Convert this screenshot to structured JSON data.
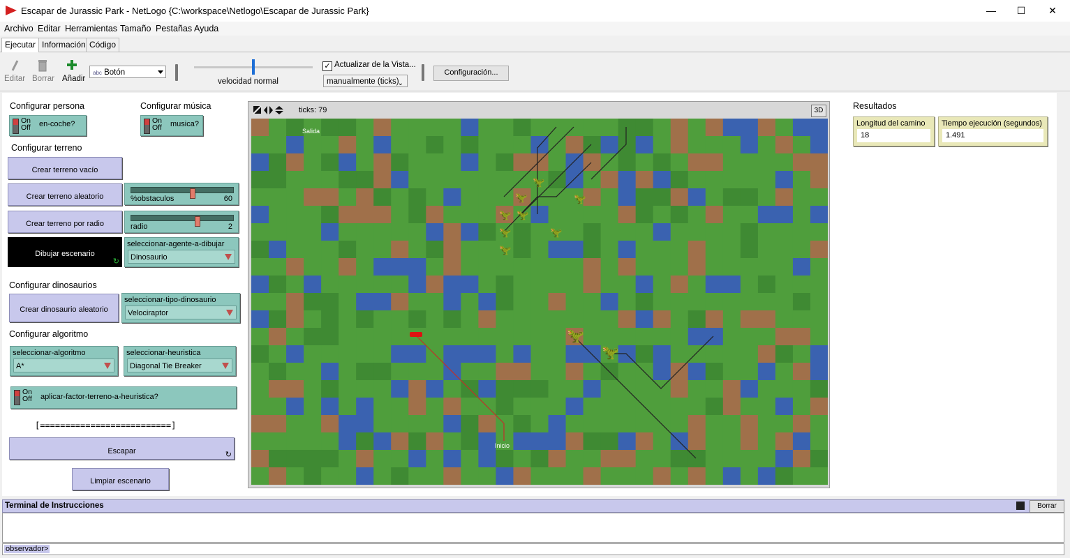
{
  "window": {
    "title": "Escapar de Jurassic Park - NetLogo {C:\\workspace\\Netlogo\\Escapar de Jurassic Park}",
    "minimize": "—",
    "maximize": "☐",
    "close": "✕"
  },
  "menu": [
    "Archivo",
    "Editar",
    "Herramientas",
    "Tamaño",
    "Pestañas",
    "Ayuda"
  ],
  "tabs": [
    "Ejecutar",
    "Información",
    "Código"
  ],
  "toolbar": {
    "edit_label": "Editar",
    "delete_label": "Borrar",
    "add_label": "Añadir",
    "widget_type": "Botón",
    "widget_type_icon": "abc",
    "speed_label": "velocidad normal",
    "speed_value": 0.5,
    "update_view_label": "Actualizar de la Vista...",
    "update_view_checked": true,
    "update_mode": "manualmente (ticks)",
    "settings_label": "Configuración..."
  },
  "panel": {
    "configurar_persona": "Configurar persona",
    "configurar_musica": "Configurar música",
    "switch_on": "On",
    "switch_off": "Off",
    "sw_en_coche": "en-coche?",
    "sw_musica": "musica?",
    "configurar_terreno": "Configurar terreno",
    "btn_crear_vacio": "Crear terreno vacío",
    "btn_crear_aleatorio": "Crear terreno aleatorio",
    "btn_crear_radio": "Crear terreno por radio",
    "slider_obstaculos_label": "%obstaculos",
    "slider_obstaculos_value": "60",
    "slider_obstaculos_fraction": 0.6,
    "slider_radio_label": "radio",
    "slider_radio_value": "2",
    "slider_radio_fraction": 0.65,
    "btn_dibujar": "Dibujar escenario",
    "chooser_agente_label": "seleccionar-agente-a-dibujar",
    "chooser_agente_value": "Dinosaurio",
    "configurar_dinosaurios": "Configurar dinosaurios",
    "btn_crear_dino": "Crear dinosaurio aleatorio",
    "chooser_tipo_label": "seleccionar-tipo-dinosaurio",
    "chooser_tipo_value": "Velociraptor",
    "configurar_algoritmo": "Configurar algoritmo",
    "chooser_alg_label": "seleccionar-algoritmo",
    "chooser_alg_value": "A*",
    "chooser_heur_label": "seleccionar-heuristica",
    "chooser_heur_value": "Diagonal Tie Breaker",
    "sw_factor": "aplicar-factor-terreno-a-heuristica?",
    "progress_text": "[==========================]",
    "btn_escapar": "Escapar",
    "btn_limpiar": "Limpiar escenario"
  },
  "view": {
    "ticks_label": "ticks: 79",
    "btn_3d": "3D",
    "label_inicio": "Inicio",
    "label_salida": "Salida"
  },
  "results": {
    "title": "Resultados",
    "monitor1_label": "Longitud del camino",
    "monitor1_value": "18",
    "monitor2_label": "Tiempo ejecución (segundos)",
    "monitor2_value": "1.491"
  },
  "terminal": {
    "title": "Terminal de Instrucciones",
    "clear_label": "Borrar",
    "prompt": "observador>"
  },
  "colors": {
    "grass": "#4f9e3c",
    "dark_grass": "#3f8a33",
    "water": "#3a62b0",
    "dirt": "#a0704a"
  }
}
